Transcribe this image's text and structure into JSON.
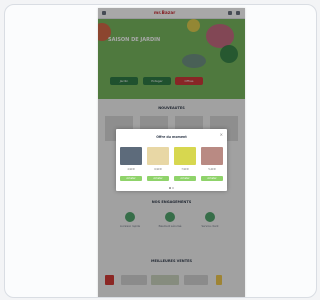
{
  "site": {
    "brand": "mr.Bazar"
  },
  "hero": {
    "title": "SAISON DE JARDIN",
    "buttons": [
      "Jardin",
      "Potager",
      "Offres"
    ]
  },
  "sections": {
    "featured": "NOUVEAUTES",
    "services": "NOS ENGAGEMENTS",
    "bestsellers": "MEILLEURES VENTES"
  },
  "modal": {
    "title": "Offre du moment",
    "close_label": "×",
    "products": [
      {
        "price": "4,99 €",
        "button": "Acheter"
      },
      {
        "price": "6,99 €",
        "button": "Acheter"
      },
      {
        "price": "7,99 €",
        "button": "Acheter"
      },
      {
        "price": "5,49 €",
        "button": "Acheter"
      }
    ]
  },
  "services": [
    {
      "label": "Livraison rapide"
    },
    {
      "label": "Paiement sécurisé"
    },
    {
      "label": "Service client"
    }
  ],
  "colors": {
    "accent": "#78b85f",
    "buy": "#8fd36a",
    "overlay": "rgba(0,0,0,.34)"
  }
}
